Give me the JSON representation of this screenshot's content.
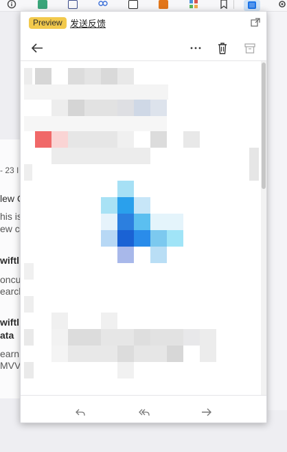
{
  "popup": {
    "badge": "Preview",
    "feedback": "发送反馈"
  },
  "background": {
    "lines": [
      "- 23 I",
      "lew C",
      "his is",
      "ew c",
      "wiftl",
      "oncu",
      "earch",
      "wiftl",
      "ata",
      "earn",
      "MVVM"
    ]
  },
  "icons": {
    "toolbar": [
      "info-icon",
      "extension-s-icon",
      "document-icon",
      "owl-icon",
      "notion-icon",
      "fox-icon",
      "grid-icon",
      "bookmark-icon",
      "divider-icon",
      "outlook-icon",
      "gear-icon"
    ],
    "header": [
      "back-arrow-icon",
      "more-options-icon",
      "delete-icon",
      "archive-icon"
    ],
    "footer": [
      "reply-icon",
      "reply-all-icon",
      "forward-icon"
    ]
  },
  "colors": {
    "badge_bg": "#f2c94c",
    "image_blue_dark": "#1a73e8",
    "image_blue_light": "#a6e0f5"
  }
}
